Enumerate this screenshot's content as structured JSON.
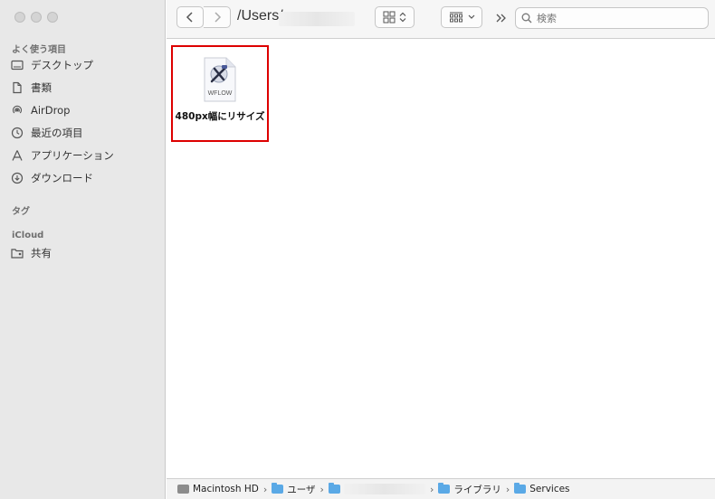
{
  "toolbar": {
    "path_title": "/Users/",
    "search_placeholder": "検索"
  },
  "sidebar": {
    "favorites_header": "よく使う項目",
    "favorites": [
      {
        "label": "デスクトップ",
        "icon": "desktop-icon"
      },
      {
        "label": "書類",
        "icon": "document-icon"
      },
      {
        "label": "AirDrop",
        "icon": "airdrop-icon"
      },
      {
        "label": "最近の項目",
        "icon": "clock-icon"
      },
      {
        "label": "アプリケーション",
        "icon": "applications-icon"
      },
      {
        "label": "ダウンロード",
        "icon": "download-icon"
      }
    ],
    "tags_header": "タグ",
    "icloud_header": "iCloud",
    "icloud": [
      {
        "label": "共有",
        "icon": "shared-folder-icon"
      }
    ]
  },
  "content": {
    "file": {
      "name": "480px幅にリサイズ",
      "type_label": "WFLOW",
      "selected_color": "#dd0000"
    }
  },
  "pathbar": {
    "items": [
      "Macintosh HD",
      "ユーザ",
      "",
      "ライブラリ",
      "Services"
    ]
  }
}
